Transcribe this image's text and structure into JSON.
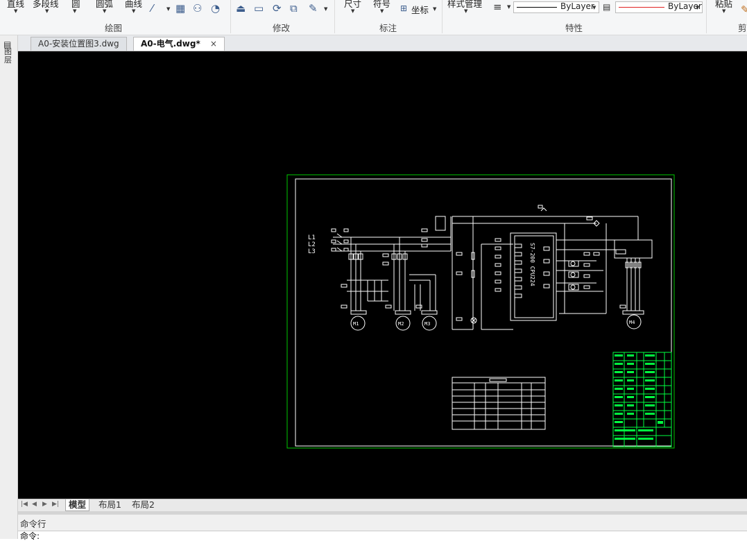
{
  "ribbon": {
    "draw_tools": [
      "直线",
      "多段线",
      "圆",
      "圆弧",
      "曲线"
    ],
    "annot_tools": [
      "尺寸",
      "符号",
      "坐标"
    ],
    "style_manager": "样式管理",
    "paste": "粘贴",
    "groups": {
      "draw": "绘图",
      "modify": "修改",
      "annotation": "标注",
      "properties": "特性",
      "clipboard": "剪"
    },
    "linetype_value": "ByLayer",
    "color_value": "ByLayer",
    "linetype_color": "#000000",
    "color_line_color": "#e02020"
  },
  "left_strip": {
    "label": "图层"
  },
  "tabs": [
    {
      "label": "A0-安装位置图3.dwg",
      "active": false
    },
    {
      "label": "A0-电气.dwg*",
      "active": true
    }
  ],
  "tab_close_icon": "×",
  "drawing": {
    "background": "#000000",
    "frame_color": "#00c800",
    "line_color": "#ffffff",
    "highlight_color": "#00ff40",
    "phase_labels": [
      "L1",
      "L2",
      "L3"
    ],
    "plc_label": "S7-200 CPU224",
    "motor_labels": [
      "M1",
      "M2",
      "M3",
      "M4"
    ]
  },
  "layout_tabs": [
    {
      "label": "模型",
      "active": true
    },
    {
      "label": "布局1",
      "active": false
    },
    {
      "label": "布局2",
      "active": false
    }
  ],
  "command": {
    "title": "命令行",
    "prompt": "命令:"
  }
}
